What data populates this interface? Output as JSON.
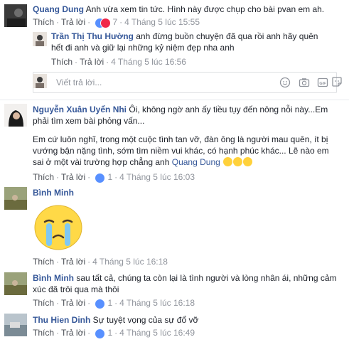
{
  "comments": [
    {
      "name": "Quang Dung",
      "text": "Anh vừa xem tin tức. Hình này được chụp cho bài pvan em ah.",
      "like_label": "Thích",
      "reply_label": "Trả lời",
      "reactions_count": "7",
      "time": "4 Tháng 5 lúc 15:55"
    },
    {
      "name": "Trần Thị Thu Hường",
      "text_line1": "anh đừng buồn chuyện đã qua rồi anh hãy quên",
      "text_line2": "hết đi anh và giữ lại những kỷ niệm đẹp nha anh",
      "like_label": "Thích",
      "reply_label": "Trả lời",
      "time": "4 Tháng 5 lúc 16:56"
    },
    {
      "name": "Nguyễn Xuân Uyển Nhi",
      "text_line1": "Ôi, không ngờ anh ấy tiều tụy đến nông nỗi này...Em",
      "text_line2": "phải tìm xem bài phỏng vấn...",
      "para_line1": "Em cứ luôn nghĩ, trong một cuộc tình tan vỡ, đàn ông là người mau quên, ít bị",
      "para_line2": "vướng bận nặng tình, sớm tìm niềm vui khác, có hạnh phúc khác... Lẽ nào em",
      "para_line3_pre": "sai ở một vài trường hợp chẳng anh",
      "mention": "Quang Dung",
      "like_label": "Thích",
      "reply_label": "Trả lời",
      "reactions_count": "1",
      "time": "4 Tháng 5 lúc 16:03"
    },
    {
      "name": "Bình Minh",
      "like_label": "Thích",
      "reply_label": "Trả lời",
      "time": "4 Tháng 5 lúc 16:18"
    },
    {
      "name": "Bình Minh",
      "text_line1": "sau tất cả, chúng ta còn lại là tình người và lòng nhân ái, những cảm",
      "text_line2": "xúc đã trôi qua mà thôi",
      "like_label": "Thích",
      "reply_label": "Trả lời",
      "reactions_count": "1",
      "time": "4 Tháng 5 lúc 16:18"
    },
    {
      "name": "Thu Hien Dinh",
      "text": "Sự tuyệt vọng của sự đổ vỡ",
      "like_label": "Thích",
      "reply_label": "Trả lời",
      "reactions_count": "1",
      "time": "4 Tháng 5 lúc 16:49"
    }
  ],
  "reply_box": {
    "placeholder": "Viết trả lời..."
  },
  "colors": {
    "link": "#365899",
    "meta": "#90949c",
    "like": "#5890ff",
    "love": "#f0284a"
  }
}
